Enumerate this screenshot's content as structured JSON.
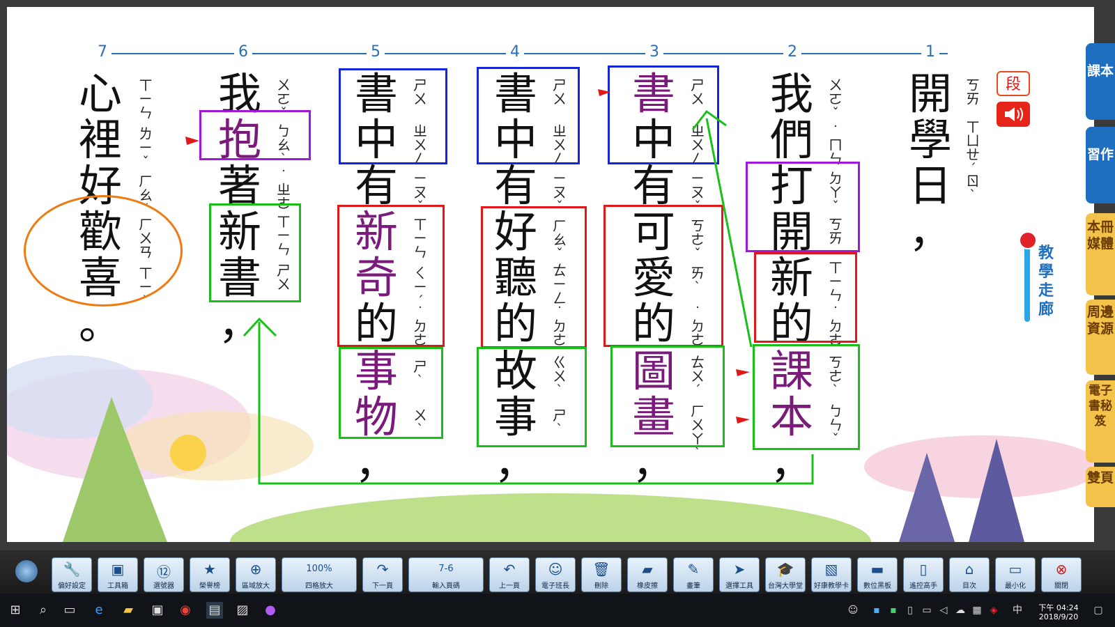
{
  "columns": [
    "7",
    "6",
    "5",
    "4",
    "3",
    "2",
    "1"
  ],
  "title": {
    "chars": [
      "開",
      "學",
      "日",
      "，"
    ],
    "zhuyin": [
      "ㄎㄞ",
      "ㄒㄩㄝˊ",
      "ㄖˋ"
    ]
  },
  "col2": {
    "chars": [
      "我",
      "們",
      "打",
      "開",
      "新",
      "的",
      "課",
      "本",
      "，"
    ],
    "zhuyin": [
      "ㄨㄛˇ",
      "˙ㄇㄣ",
      "ㄉㄚˇ",
      "ㄎㄞ",
      "ㄒㄧㄣ",
      "˙ㄉㄜ",
      "ㄎㄜˋ",
      "ㄅㄣˇ"
    ]
  },
  "col3": {
    "chars": [
      "書",
      "中",
      "有",
      "可",
      "愛",
      "的",
      "圖",
      "畫",
      "，"
    ],
    "zhuyin": [
      "ㄕㄨ",
      "ㄓㄨㄥ",
      "ㄧㄡˇ",
      "ㄎㄜˇ",
      "ㄞˋ",
      "˙ㄉㄜ",
      "ㄊㄨˊ",
      "ㄏㄨㄚˋ"
    ]
  },
  "col4": {
    "chars": [
      "書",
      "中",
      "有",
      "好",
      "聽",
      "的",
      "故",
      "事",
      "，"
    ],
    "zhuyin": [
      "ㄕㄨ",
      "ㄓㄨㄥ",
      "ㄧㄡˇ",
      "ㄏㄠˇ",
      "ㄊㄧㄥ",
      "˙ㄉㄜ",
      "ㄍㄨˋ",
      "ㄕˋ"
    ]
  },
  "col5": {
    "chars": [
      "書",
      "中",
      "有",
      "新",
      "奇",
      "的",
      "事",
      "物",
      "，"
    ],
    "zhuyin": [
      "ㄕㄨ",
      "ㄓㄨㄥ",
      "ㄧㄡˇ",
      "ㄒㄧㄣ",
      "ㄑㄧˊ",
      "˙ㄉㄜ",
      "ㄕˋ",
      "ㄨˋ"
    ]
  },
  "col6": {
    "chars": [
      "我",
      "抱",
      "著",
      "新",
      "書",
      "，"
    ],
    "zhuyin": [
      "ㄨㄛˇ",
      "ㄅㄠˋ",
      "˙ㄓㄜ",
      "ㄒㄧㄣ",
      "ㄕㄨ"
    ]
  },
  "col7": {
    "chars": [
      "心",
      "裡",
      "好",
      "歡",
      "喜",
      "。"
    ],
    "zhuyin": [
      "ㄒㄧㄣ",
      "ㄌㄧˇ",
      "ㄏㄠˇ",
      "ㄏㄨㄢ",
      "ㄒㄧˇ"
    ]
  },
  "top_right": {
    "paragraph_label": "段",
    "speaker_icon": "speaker-icon"
  },
  "side_tabs": [
    {
      "label": "課本",
      "color": "#1f6fc0"
    },
    {
      "label": "習作",
      "color": "#1f6fc0"
    },
    {
      "label": "本冊媒體",
      "color": "#f3c24a"
    },
    {
      "label": "周邊資源",
      "color": "#f3c24a"
    },
    {
      "label": "電子書秘笈",
      "color": "#f3c24a"
    },
    {
      "label": "雙頁",
      "color": "#f3c24a"
    }
  ],
  "corridor": {
    "label": "教學走廊"
  },
  "toolbar": [
    {
      "label": "偏好設定",
      "icon": "wrench-icon"
    },
    {
      "label": "工具箱",
      "icon": "toolbox-icon"
    },
    {
      "label": "選號器",
      "icon": "number-picker-icon"
    },
    {
      "label": "榮譽榜",
      "icon": "medal-icon"
    },
    {
      "label": "區域放大",
      "icon": "zoom-in-icon"
    },
    {
      "label": "四格放大",
      "icon": "four-grid-icon",
      "value": "100%"
    },
    {
      "label": "下一頁",
      "icon": "next-page-icon"
    },
    {
      "label": "輸入頁碼",
      "icon": "page-input-icon",
      "value": "7-6"
    },
    {
      "label": "上一頁",
      "icon": "prev-page-icon"
    },
    {
      "label": "電子班長",
      "icon": "monitor-person-icon"
    },
    {
      "label": "刪除",
      "icon": "trash-icon"
    },
    {
      "label": "橡皮擦",
      "icon": "eraser-icon"
    },
    {
      "label": "畫筆",
      "icon": "pen-icon"
    },
    {
      "label": "選擇工具",
      "icon": "cursor-icon"
    },
    {
      "label": "台灣大學堂",
      "icon": "grad-cap-icon"
    },
    {
      "label": "好康教學卡",
      "icon": "card-icon"
    },
    {
      "label": "數位黑板",
      "icon": "blackboard-icon"
    },
    {
      "label": "遙控高手",
      "icon": "phone-icon"
    },
    {
      "label": "目次",
      "icon": "home-icon"
    },
    {
      "label": "最小化",
      "icon": "minimize-icon"
    },
    {
      "label": "關閉",
      "icon": "close-icon"
    }
  ],
  "clock": {
    "time": "下午 04:24",
    "date": "2018/9/20"
  },
  "tray": {
    "ime": "中"
  }
}
